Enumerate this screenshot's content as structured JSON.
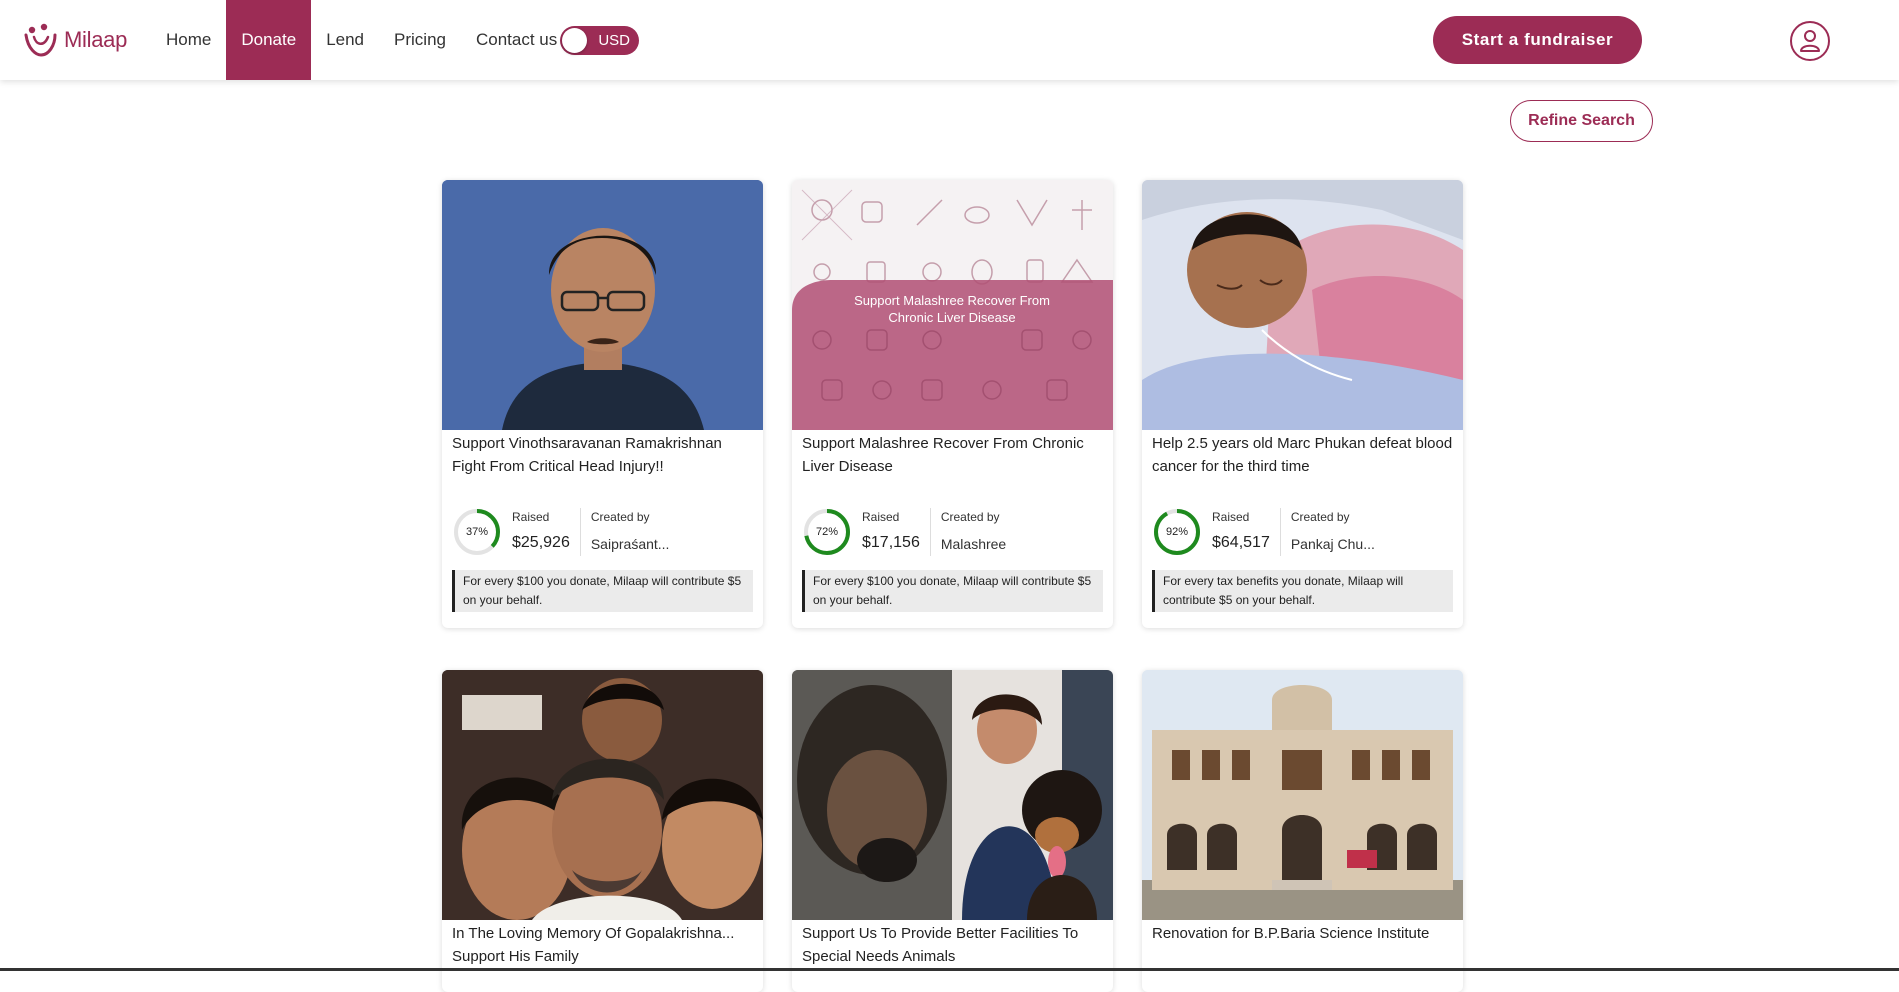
{
  "header": {
    "logo_text": "Milaap",
    "nav": [
      {
        "label": "Home",
        "active": false
      },
      {
        "label": "Donate",
        "active": true
      },
      {
        "label": "Lend",
        "active": false
      },
      {
        "label": "Pricing",
        "active": false
      },
      {
        "label": "Contact us",
        "active": false
      }
    ],
    "currency": "USD",
    "start_fundraiser_label": "Start a fundraiser",
    "profile_icon": "user-profile-icon"
  },
  "refine_search_label": "Refine Search",
  "labels": {
    "raised": "Raised",
    "created_by": "Created by"
  },
  "cards": [
    {
      "title": "Support Vinothsaravanan Ramakrishnan Fight From Critical Head Injury!!",
      "percent": 37,
      "percent_label": "37%",
      "raised": "$25,926",
      "creator": "Saipraśant...",
      "contribution": "For every $100 you donate, Milaap will contribute $5 on your behalf."
    },
    {
      "title": "Support Malashree Recover From Chronic Liver Disease",
      "image_text": "Support Malashree Recover From Chronic Liver Disease",
      "percent": 72,
      "percent_label": "72%",
      "raised": "$17,156",
      "creator": "Malashree",
      "contribution": "For every $100 you donate, Milaap will contribute $5 on your behalf."
    },
    {
      "title": "Help 2.5 years old Marc Phukan defeat blood cancer for the third time",
      "percent": 92,
      "percent_label": "92%",
      "raised": "$64,517",
      "creator": "Pankaj Chu...",
      "contribution": "For every tax benefits you donate, Milaap will contribute $5 on your behalf."
    },
    {
      "title": "In The Loving Memory Of Gopalakrishna... Support His Family"
    },
    {
      "title": "Support Us To Provide Better Facilities To Special Needs Animals"
    },
    {
      "title": "Renovation for B.P.Baria Science Institute"
    }
  ],
  "colors": {
    "brand": "#9c2c55",
    "progress": "#1e8a1e"
  }
}
